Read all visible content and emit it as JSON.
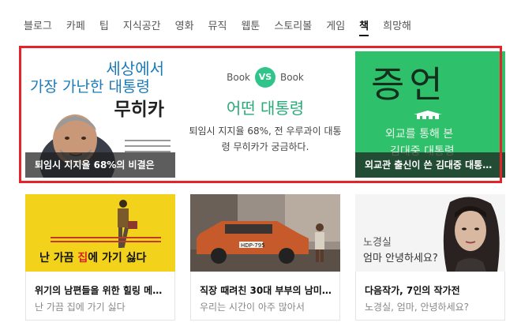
{
  "nav": {
    "items": [
      {
        "label": "블로그",
        "active": false
      },
      {
        "label": "카페",
        "active": false
      },
      {
        "label": "팁",
        "active": false
      },
      {
        "label": "지식공간",
        "active": false
      },
      {
        "label": "영화",
        "active": false
      },
      {
        "label": "뮤직",
        "active": false
      },
      {
        "label": "웹툰",
        "active": false
      },
      {
        "label": "스토리볼",
        "active": false
      },
      {
        "label": "게임",
        "active": false
      },
      {
        "label": "책",
        "active": true
      },
      {
        "label": "희망해",
        "active": false
      }
    ]
  },
  "feature": {
    "border_color": "#e2242b",
    "left": {
      "cover_line1": "세상에서",
      "cover_line2": "가장 가난한 대통령",
      "cover_line3": "무히카",
      "caption": "퇴임시 지지율 68%의 비결은"
    },
    "center": {
      "book_left": "Book",
      "vs": "VS",
      "book_right": "Book",
      "title": "어떤 대통령",
      "description": "퇴임시 지지율 68%, 전 우루과이 대통령 무히카가 궁금하다.",
      "accent_color": "#2fc489"
    },
    "right": {
      "cover_title": "증언",
      "cover_sub1": "외교를 통해 본",
      "cover_sub2": "김대중 대통령",
      "caption": "외교관 출신이 쓴 김대중 대통…",
      "background_color": "#2fc06b"
    }
  },
  "tiles": [
    {
      "cover_text_plain1": "난 가끔 ",
      "cover_text_red": "집",
      "cover_text_plain2": "에 가기 싫다",
      "title": "위기의 남편들을 위한 힐링 메…",
      "subtitle": "난 가끔 집에 가기 싫다"
    },
    {
      "plate": "HDP-795",
      "title": "직장 때려친 30대 부부의 남미…",
      "subtitle": "우리는 시간이 아주 많아서"
    },
    {
      "cover_name": "노경실",
      "cover_line": "엄마 안녕하세요?",
      "title": "다음작가, 7인의 작가전",
      "subtitle": "노경실, 엄마, 안녕하세요?"
    }
  ]
}
